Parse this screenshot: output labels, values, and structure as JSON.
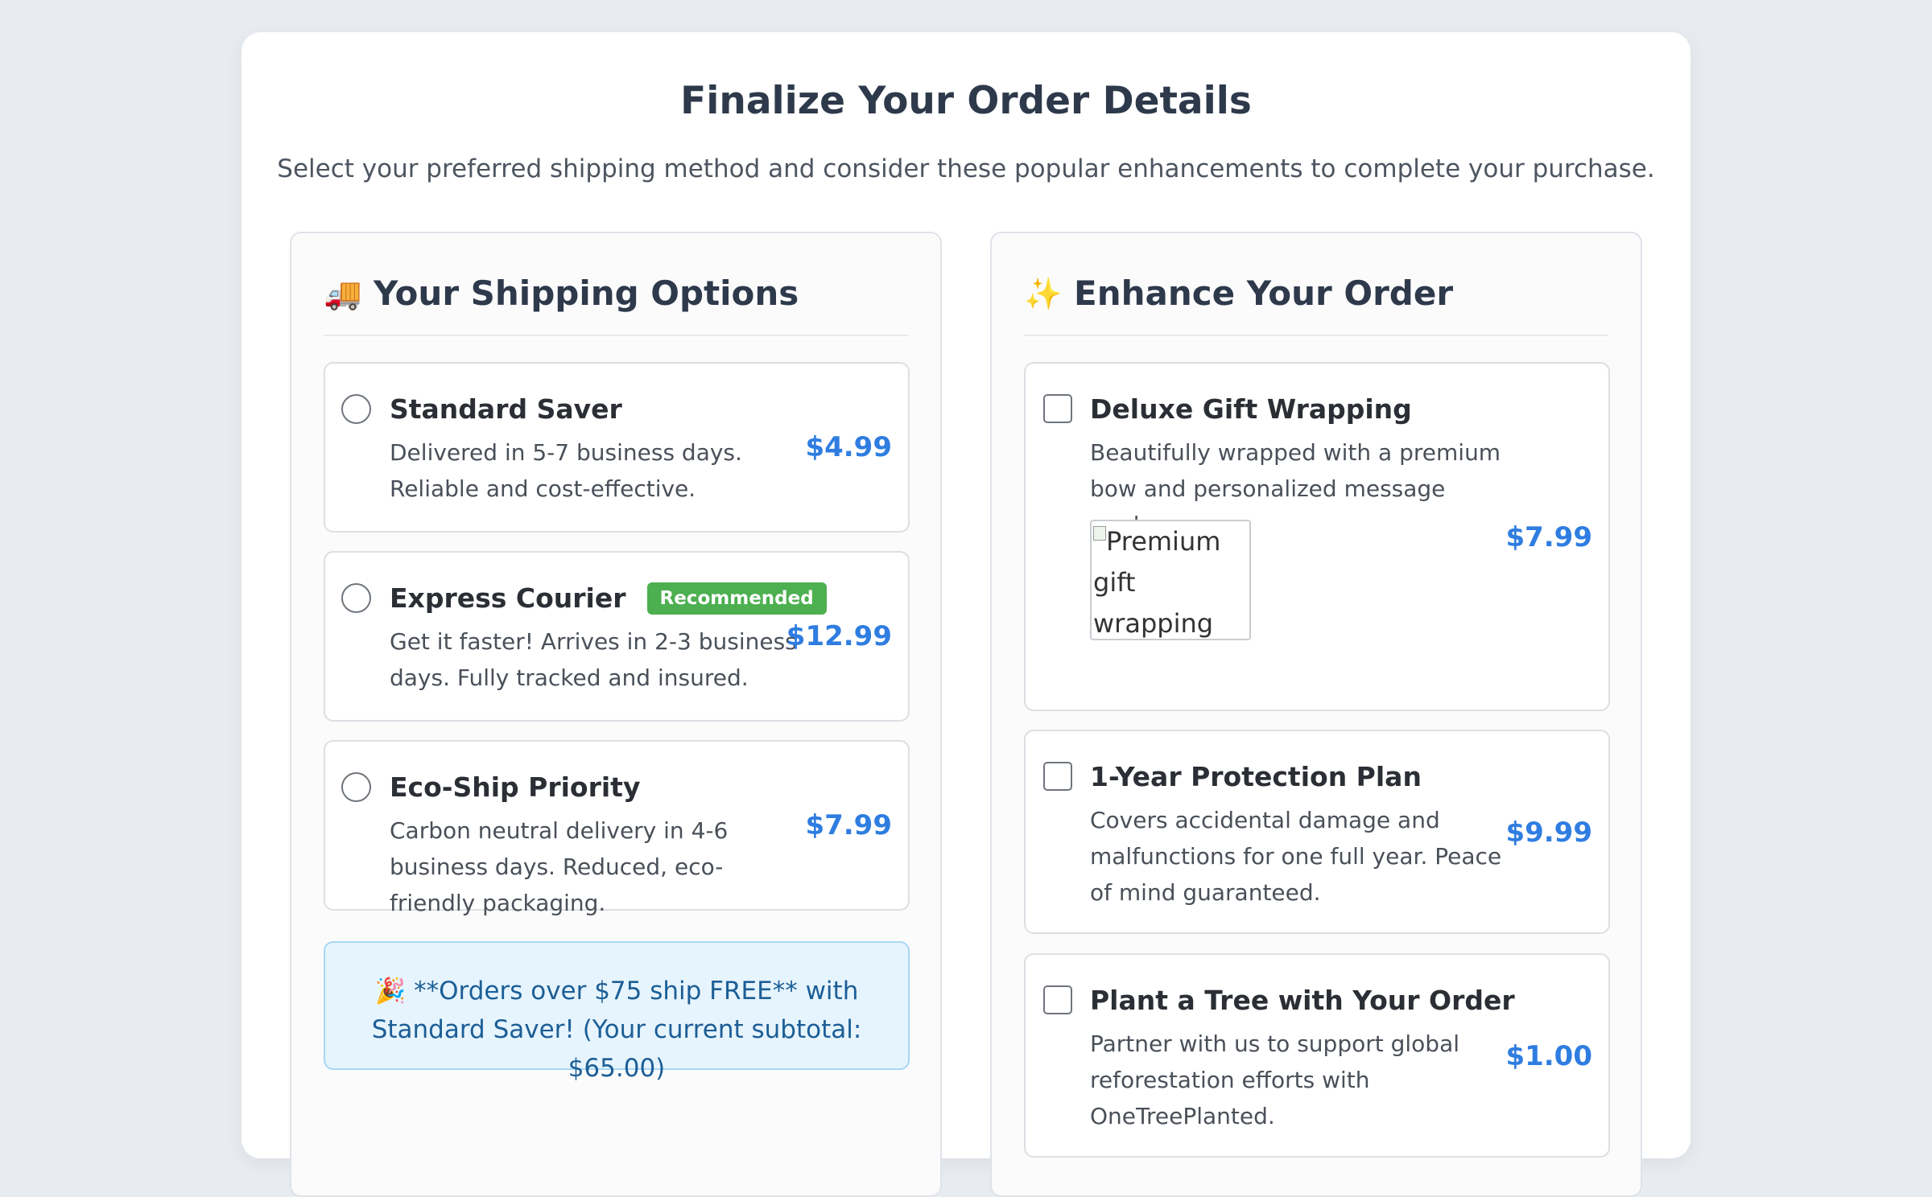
{
  "header": {
    "title": "Finalize Your Order Details",
    "subtitle": "Select your preferred shipping method and consider these popular enhancements to complete your purchase."
  },
  "shipping": {
    "icon": "delivery-truck-icon",
    "icon_glyph": "🚚",
    "title": "Your Shipping Options",
    "options": [
      {
        "name": "Standard Saver",
        "description": "Delivered in 5-7 business days. Reliable and cost-effective.",
        "price": "$4.99",
        "selected": false
      },
      {
        "name": "Express Courier",
        "badge": "Recommended",
        "description": "Get it faster! Arrives in 2-3 business days. Fully tracked and insured.",
        "price": "$12.99",
        "selected": false
      },
      {
        "name": "Eco-Ship Priority",
        "description": "Carbon neutral delivery in 4-6 business days. Reduced, eco-friendly packaging.",
        "price": "$7.99",
        "selected": false
      }
    ],
    "promo": {
      "icon": "party-popper-icon",
      "icon_glyph": "🎉",
      "text": "**Orders over $75 ship FREE** with Standard Saver! (Your current subtotal: $65.00)"
    }
  },
  "enhancements": {
    "icon": "sparkles-icon",
    "icon_glyph": "✨",
    "title": "Enhance Your Order",
    "options": [
      {
        "name": "Deluxe Gift Wrapping",
        "description": "Beautifully wrapped with a premium bow and personalized message card.",
        "price": "$7.99",
        "image_alt": "Premium gift wrapping with elegant",
        "checked": false
      },
      {
        "name": "1-Year Protection Plan",
        "description": "Covers accidental damage and malfunctions for one full year. Peace of mind guaranteed.",
        "price": "$9.99",
        "checked": false
      },
      {
        "name": "Plant a Tree with Your Order",
        "description": "Partner with us to support global reforestation efforts with OneTreePlanted.",
        "price": "$1.00",
        "checked": false
      }
    ]
  },
  "colors": {
    "accent_price": "#2f7de1",
    "badge_green": "#4caf50",
    "promo_bg": "#e6f4fd",
    "promo_text": "#1c5e96"
  }
}
